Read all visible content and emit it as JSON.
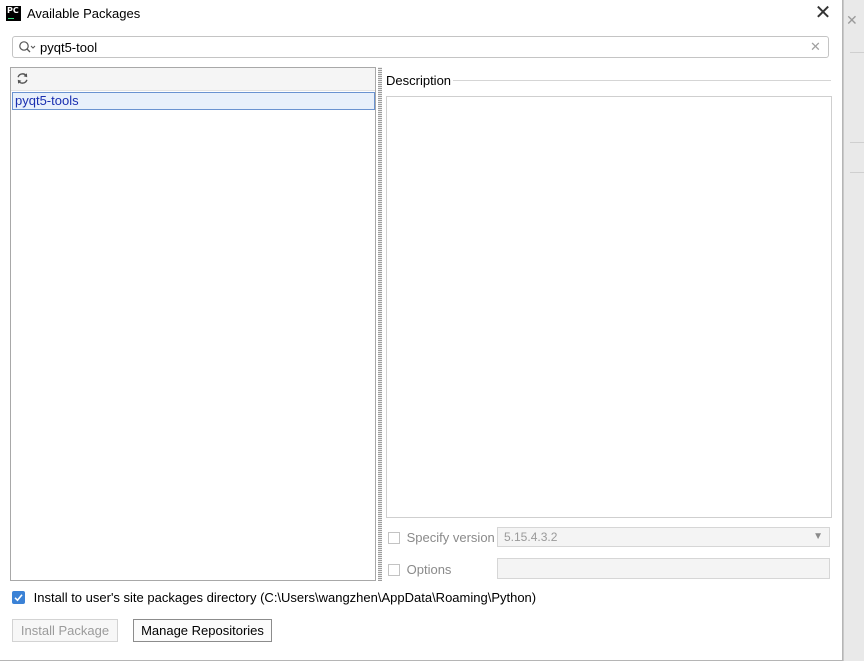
{
  "window": {
    "title": "Available Packages"
  },
  "search": {
    "value": "pyqt5-tool"
  },
  "packages": [
    {
      "name": "pyqt5-tools",
      "selected": true
    }
  ],
  "description": {
    "label": "Description"
  },
  "specify_version": {
    "label": "Specify version",
    "checked": false,
    "version_value": "5.15.4.3.2"
  },
  "options": {
    "label": "Options",
    "checked": false,
    "value": ""
  },
  "install_user": {
    "label": "Install to user's site packages directory (C:\\Users\\wangzhen\\AppData\\Roaming\\Python)",
    "checked": true
  },
  "buttons": {
    "install": "Install Package",
    "manage": "Manage Repositories"
  },
  "colors": {
    "accent": "#3b82d6",
    "selection_text": "#1a2fb0",
    "selection_bg": "#e8f0fb"
  },
  "icons": {
    "app": "pycharm-icon",
    "close": "close-icon",
    "search": "search-icon",
    "clear": "clear-icon",
    "refresh": "refresh-icon",
    "dropdown": "chevron-down-icon",
    "check": "checkmark-icon"
  }
}
